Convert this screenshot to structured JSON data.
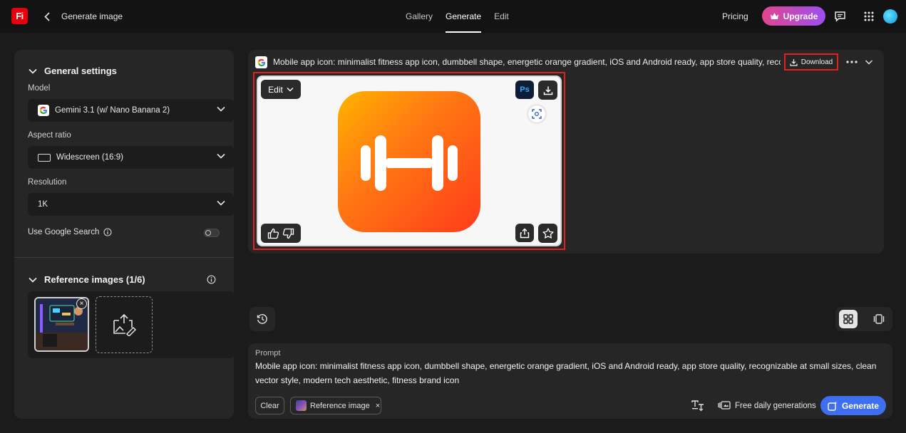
{
  "topbar": {
    "logo_text": "Fi",
    "title": "Generate image",
    "tabs": [
      {
        "label": "Gallery",
        "active": false
      },
      {
        "label": "Generate",
        "active": true
      },
      {
        "label": "Edit",
        "active": false
      }
    ],
    "pricing_label": "Pricing",
    "upgrade_label": "Upgrade"
  },
  "settings": {
    "section_title": "General settings",
    "model_label": "Model",
    "model_value": "Gemini 3.1 (w/ Nano Banana 2)",
    "aspect_label": "Aspect ratio",
    "aspect_value": "Widescreen (16:9)",
    "resolution_label": "Resolution",
    "resolution_value": "1K",
    "google_search_label": "Use Google Search",
    "google_search_enabled": false
  },
  "references": {
    "section_title": "Reference images (1/6)"
  },
  "result": {
    "prompt_preview": "Mobile app icon: minimalist fitness app icon, dumbbell shape, energetic orange gradient, iOS and Android ready, app store quality, recognizable at small sizes, clean vector style, modern tech aesthetic, fitness brand icon",
    "download_label": "Download",
    "edit_label": "Edit",
    "ps_label": "Ps"
  },
  "prompt": {
    "label": "Prompt",
    "text": "Mobile app icon: minimalist fitness app icon, dumbbell shape, energetic orange gradient, iOS and Android ready, app store quality, recognizable at small sizes, clean vector style, modern tech aesthetic, fitness brand icon",
    "clear_label": "Clear",
    "reference_chip_label": "Reference image",
    "free_label": "Free daily generations",
    "generate_label": "Generate"
  },
  "colors": {
    "brand_red": "#e8000d",
    "generate_blue": "#3f6ff1",
    "highlight_red": "#e1201f",
    "icon_orange_start": "#ffb300",
    "icon_orange_end": "#ff3b1a"
  }
}
